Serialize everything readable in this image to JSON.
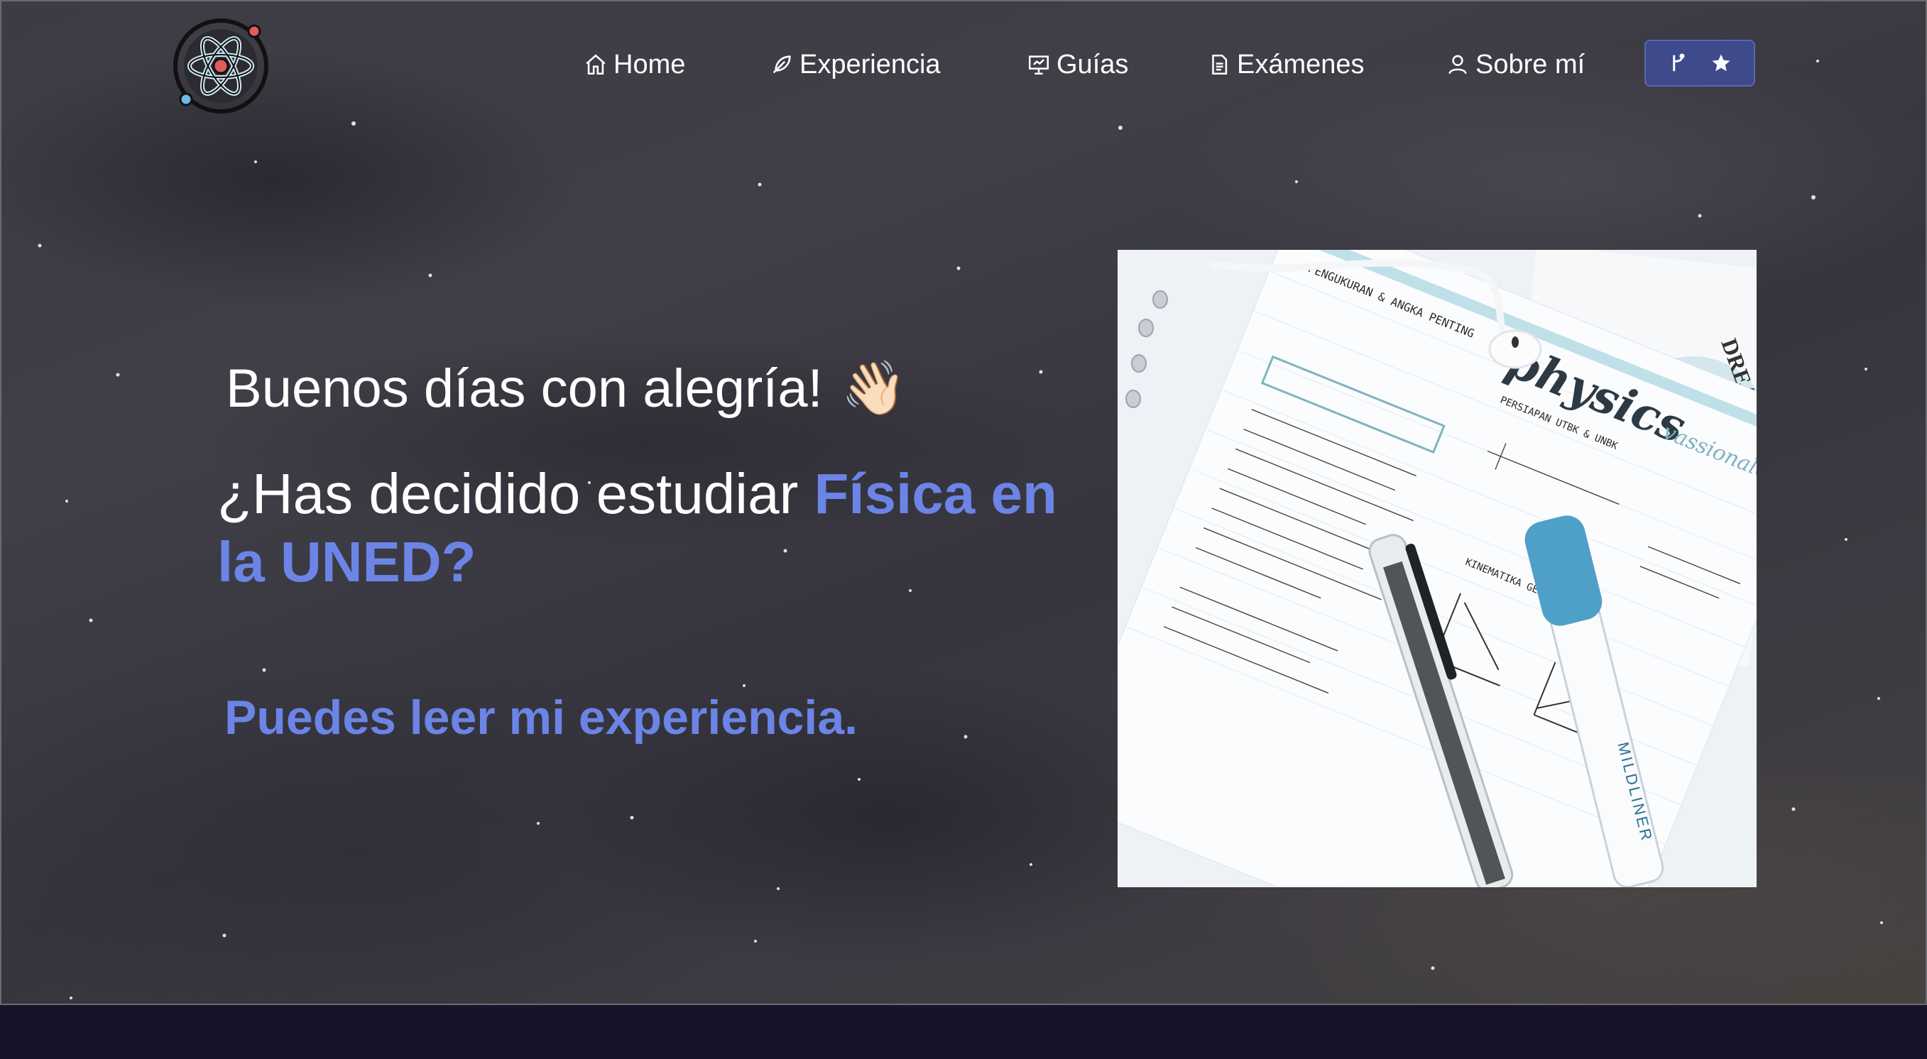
{
  "nav": {
    "items": [
      {
        "label": "Home",
        "icon": "home-icon"
      },
      {
        "label": "Experiencia",
        "icon": "feather-pen-icon"
      },
      {
        "label": "Guías",
        "icon": "presentation-chart-icon"
      },
      {
        "label": "Exámenes",
        "icon": "document-icon"
      },
      {
        "label": "Sobre mí",
        "icon": "user-icon"
      }
    ],
    "repo_button": {
      "icons": [
        "git-branch-icon",
        "star-icon"
      ]
    }
  },
  "hero": {
    "greeting": "Buenos días con alegría!",
    "greeting_emoji": "👋🏻",
    "question_prefix": "¿Has decidido estudiar ",
    "question_highlight": "Física en la UNED?",
    "cta": "Puedes leer mi experiencia."
  },
  "photo": {
    "notebook_title": "physics",
    "brand_text": "vassionale",
    "heading_1": "PENGUKURAN & ANGKA PENTING",
    "subheading_1": "PERSIAPAN UTBK & UNBK",
    "heading_2": "KINEMATIKA GERAK",
    "pen_brand": "MILDLINER",
    "corner_text": "DREA"
  },
  "colors": {
    "accent": "#6b84e6",
    "repo_button": "#3f4a8c",
    "background": "#3b3a42",
    "footer": "#16132a"
  }
}
